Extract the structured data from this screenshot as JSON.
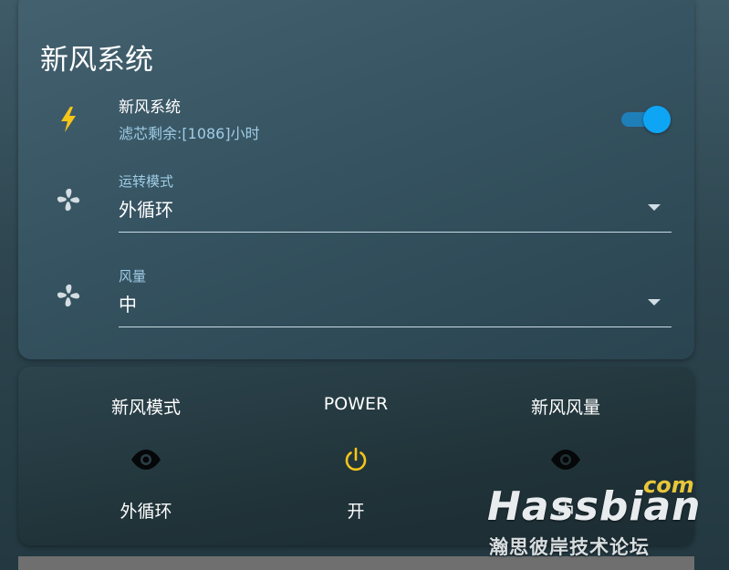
{
  "card": {
    "title": "新风系统",
    "switch": {
      "name": "新风系统",
      "secondary": "滤芯剩余:[1086]小时",
      "state": "on",
      "icon": "lightning-bolt-icon",
      "accent_color": "#f5c518"
    },
    "mode_select": {
      "label": "运转模式",
      "value": "外循环",
      "icon": "fan-icon"
    },
    "speed_select": {
      "label": "风量",
      "value": "中",
      "icon": "fan-icon"
    }
  },
  "glance": {
    "items": [
      {
        "title": "新风模式",
        "icon": "eye-icon",
        "state": "外循环"
      },
      {
        "title": "POWER",
        "icon": "power-icon",
        "state": "开",
        "icon_color": "#f5c518"
      },
      {
        "title": "新风风量",
        "icon": "eye-icon",
        "state": "中"
      }
    ]
  },
  "watermark": {
    "com": "com",
    "brand": "Hassbian",
    "subtitle": "瀚思彼岸技术论坛"
  },
  "colors": {
    "toggle_on": "#0ea5f5",
    "secondary_text": "#9fcde6"
  }
}
